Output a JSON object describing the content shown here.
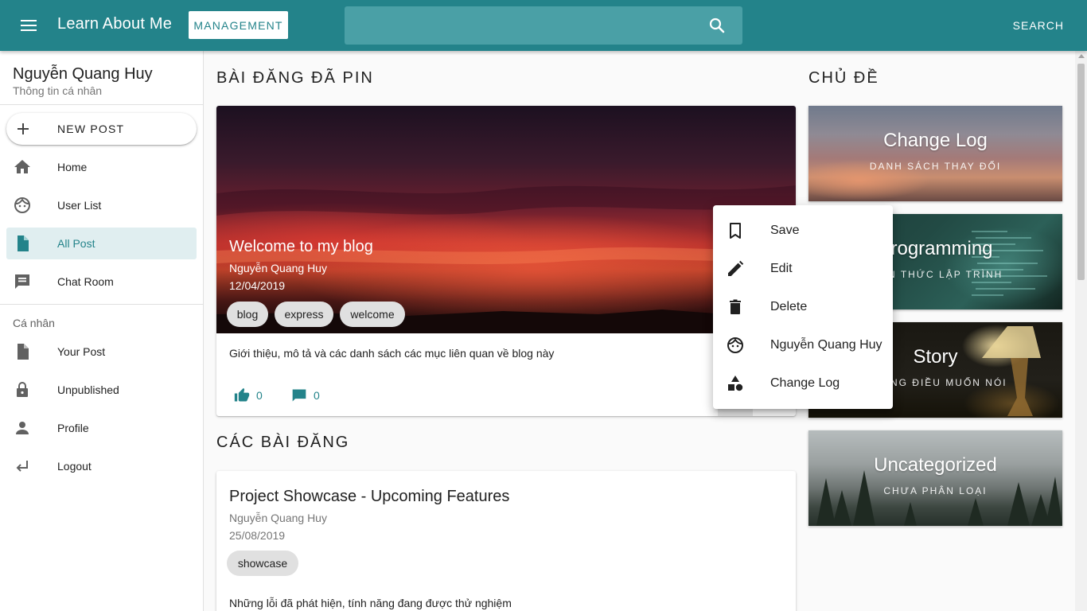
{
  "appbar": {
    "menu_icon": "menu-icon",
    "title": "Learn About Me",
    "management_label": "MANAGEMENT",
    "search_placeholder": "",
    "search_icon": "search-icon",
    "search_label": "SEARCH",
    "color": "#23838a"
  },
  "drawer": {
    "user_name": "Nguyễn Quang Huy",
    "user_subtitle": "Thông tin cá nhân",
    "new_post_label": "NEW POST",
    "items": [
      {
        "label": "Home",
        "icon": "home-icon",
        "active": false
      },
      {
        "label": "User List",
        "icon": "face-icon",
        "active": false
      },
      {
        "label": "All Post",
        "icon": "document-icon",
        "active": true
      },
      {
        "label": "Chat Room",
        "icon": "chat-icon",
        "active": false
      }
    ],
    "personal_section_label": "Cá nhân",
    "personal_items": [
      {
        "label": "Your Post",
        "icon": "document-icon"
      },
      {
        "label": "Unpublished",
        "icon": "lock-icon"
      },
      {
        "label": "Profile",
        "icon": "person-icon"
      },
      {
        "label": "Logout",
        "icon": "logout-icon"
      }
    ]
  },
  "pinned": {
    "section_title": "BÀI ĐĂNG ĐÃ PIN",
    "post": {
      "title": "Welcome to my blog",
      "author": "Nguyễn Quang Huy",
      "date": "12/04/2019",
      "tags": [
        "blog",
        "express",
        "welcome"
      ],
      "description": "Giới thiệu, mô tả và các danh sách các mục liên quan về blog này",
      "likes": "0",
      "comments": "0"
    }
  },
  "posts": {
    "section_title": "CÁC BÀI ĐĂNG",
    "items": [
      {
        "title": "Project Showcase - Upcoming Features",
        "author": "Nguyễn Quang Huy",
        "date": "25/08/2019",
        "tags": [
          "showcase"
        ],
        "description": "Những lỗi đã phát hiện, tính năng đang được thử nghiệm"
      }
    ]
  },
  "topics": {
    "section_title": "CHỦ ĐỀ",
    "items": [
      {
        "name": "Change Log",
        "subtitle": "DANH SÁCH THAY ĐỔI"
      },
      {
        "name": "Programming",
        "subtitle": "KIẾN THỨC LẬP TRÌNH"
      },
      {
        "name": "Story",
        "subtitle": "NHỮNG ĐIỀU MUỐN NÓI"
      },
      {
        "name": "Uncategorized",
        "subtitle": "CHƯA PHÂN LOẠI"
      }
    ]
  },
  "context_menu": {
    "items": [
      {
        "label": "Save",
        "icon": "bookmark-icon"
      },
      {
        "label": "Edit",
        "icon": "pencil-icon"
      },
      {
        "label": "Delete",
        "icon": "trash-icon"
      },
      {
        "label": "Nguyễn Quang Huy",
        "icon": "face-icon"
      },
      {
        "label": "Change Log",
        "icon": "category-icon"
      }
    ]
  }
}
